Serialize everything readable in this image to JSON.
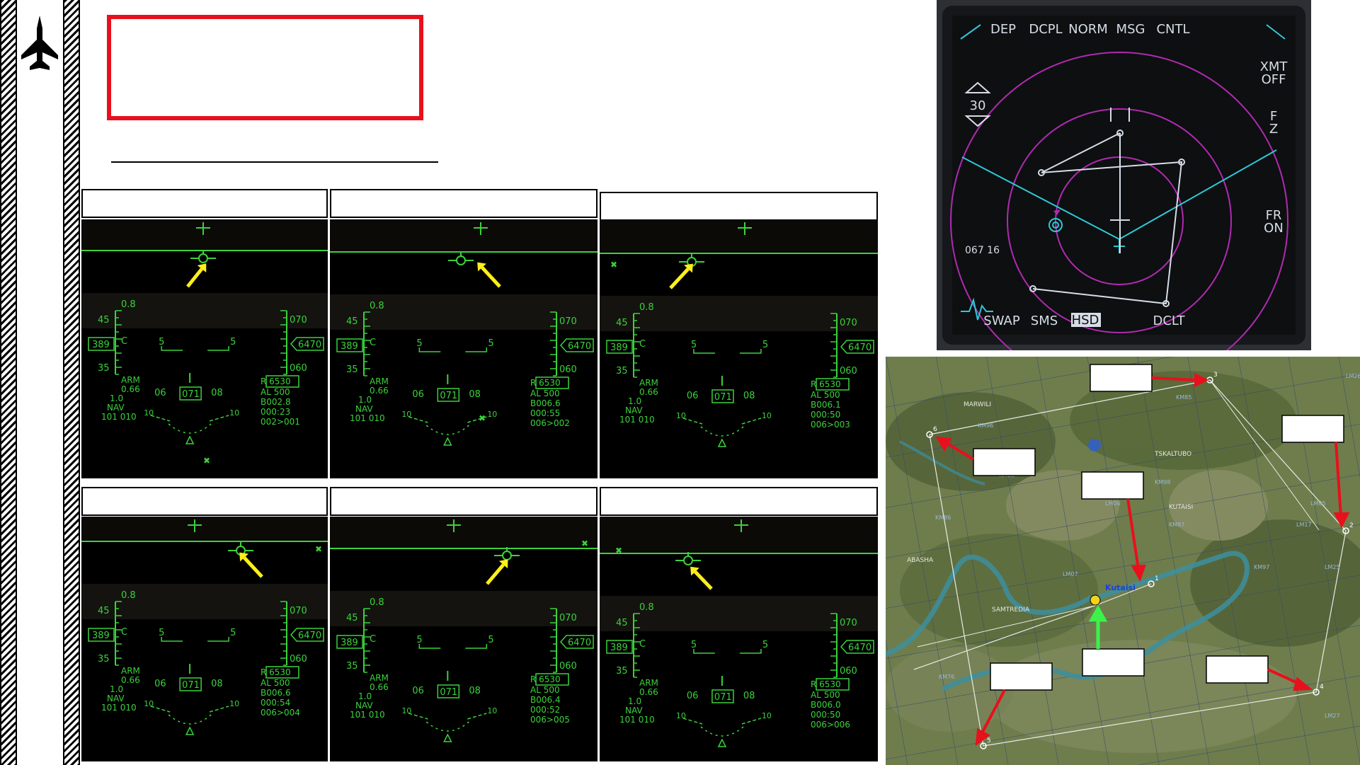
{
  "hud_panels": [
    {
      "lines": [
        "ARM",
        "0.66",
        "1.0",
        "NAV",
        "101  010"
      ],
      "range": "R 6530",
      "alt_low": "AL  500",
      "brg": "B002.8",
      "time": "000:23",
      "wpt": "002>001"
    },
    {
      "lines": [
        "ARM",
        "0.66",
        "1.0",
        "NAV",
        "101  010"
      ],
      "range": "R 6530",
      "alt_low": "AL  500",
      "brg": "B006.6",
      "time": "000:55",
      "wpt": "006>002"
    },
    {
      "lines": [
        "ARM",
        "0.66",
        "1.0",
        "NAV",
        "101  010"
      ],
      "range": "R 6530",
      "alt_low": "AL  500",
      "brg": "B006.1",
      "time": "000:50",
      "wpt": "006>003"
    },
    {
      "lines": [
        "ARM",
        "0.66",
        "1.0",
        "NAV",
        "101  010"
      ],
      "range": "R 6530",
      "alt_low": "AL  500",
      "brg": "B006.6",
      "time": "000:54",
      "wpt": "006>004"
    },
    {
      "lines": [
        "ARM",
        "0.66",
        "1.0",
        "NAV",
        "101  010"
      ],
      "range": "R 6530",
      "alt_low": "AL  500",
      "brg": "B006.4",
      "time": "000:52",
      "wpt": "006>005"
    },
    {
      "lines": [
        "ARM",
        "0.66",
        "1.0",
        "NAV",
        "101  010"
      ],
      "range": "R 6530",
      "alt_low": "AL  500",
      "brg": "B006.0",
      "time": "000:50",
      "wpt": "006>006"
    }
  ],
  "hud_common": {
    "mach": "0.8",
    "aoa_top": "45",
    "aoa_bot": "35",
    "speed": "389",
    "speed_c": "C",
    "alt": "6470",
    "alt_top": "070",
    "alt_bot": "060",
    "heading": "071",
    "hdg_left": "06",
    "hdg_right": "08",
    "pitch5": "5",
    "pitch10": "10"
  },
  "mfd": {
    "top_buttons": [
      "DEP",
      "DCPL",
      "NORM",
      "MSG",
      "CNTL"
    ],
    "bottom_buttons": [
      "SWAP",
      "SMS",
      "HSD",
      "DCLT"
    ],
    "right_labels": [
      "XMT\nOFF",
      "F\nZ",
      "FR\nON"
    ],
    "range": "30",
    "readout": "067 16"
  },
  "map": {
    "places": [
      "Kutaisi",
      "MARWILI",
      "TSKALTUBO",
      "SAMTREDIA",
      "ABASHA",
      "KUTAISI"
    ],
    "grid_labels": [
      "KM85",
      "KM96",
      "KM86",
      "LM05",
      "KM88",
      "KM98",
      "LM06",
      "KM87",
      "KM97",
      "LM07",
      "KM76",
      "LM17",
      "LM26",
      "LM25",
      "LM27"
    ],
    "waypoints": [
      "1",
      "2",
      "3",
      "4",
      "5",
      "6"
    ]
  },
  "colors": {
    "hud_green": "#3bd23b",
    "arrow_yellow": "#ffef1a",
    "red": "#e8101c",
    "magenta": "#b02ab0",
    "cyan": "#2ec9d6"
  }
}
